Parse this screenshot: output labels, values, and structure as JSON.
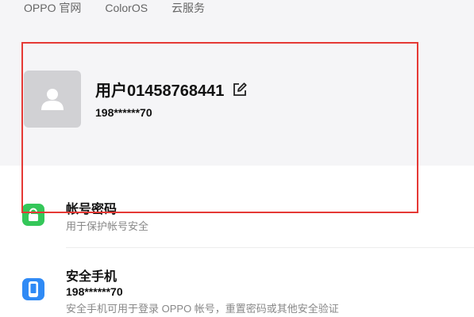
{
  "top_nav": {
    "links": [
      "OPPO 官网",
      "ColorOS",
      "云服务"
    ]
  },
  "profile": {
    "username": "用户01458768441",
    "phone": "198******70",
    "avatar_icon": "user-avatar-placeholder-icon",
    "edit_icon": "edit-pencil-icon"
  },
  "items": [
    {
      "title": "帐号密码",
      "description": "用于保护帐号安全",
      "icon": "lock-icon",
      "icon_color": "#34c759"
    },
    {
      "title": "安全手机",
      "value": "198******70",
      "description": "安全手机可用于登录 OPPO 帐号，重置密码或其他安全验证",
      "icon": "phone-icon",
      "icon_color": "#2f8af5"
    }
  ],
  "colors": {
    "header_bg": "#f5f5f7",
    "highlight_border": "#e53935",
    "avatar_bg": "#d1d1d4"
  }
}
